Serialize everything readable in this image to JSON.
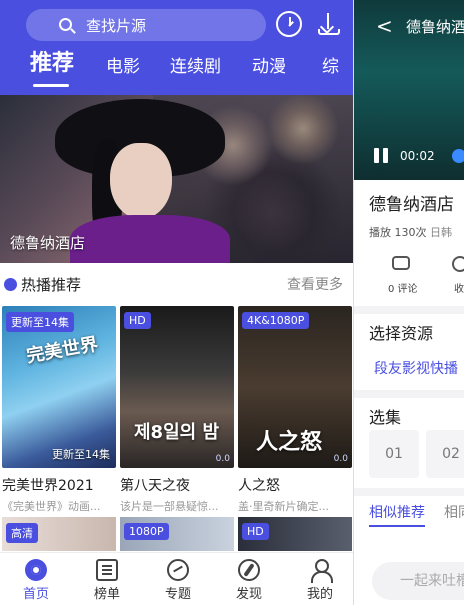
{
  "search": {
    "placeholder": "查找片源"
  },
  "icons": {
    "search": "search-icon",
    "history": "clock-icon",
    "download": "download-icon"
  },
  "tabs": [
    {
      "label": "推荐",
      "active": true
    },
    {
      "label": "电影"
    },
    {
      "label": "连续剧"
    },
    {
      "label": "动漫"
    },
    {
      "label": "综"
    }
  ],
  "banner": {
    "caption": "德鲁纳酒店"
  },
  "hot": {
    "title": "热播推荐",
    "more": "查看更多"
  },
  "cards": [
    {
      "badge": "更新至14集",
      "poster_text": "完美世界",
      "note": "更新至14集",
      "title": "完美世界2021",
      "subtitle": "《完美世界》动画..."
    },
    {
      "badge": "HD",
      "poster_text": "제8일의 밤",
      "note": "",
      "title": "第八天之夜",
      "subtitle": "该片是一部悬疑惊..."
    },
    {
      "badge": "4K&1080P",
      "poster_text": "人之怒",
      "note": "",
      "title": "人之怒",
      "subtitle": "盖·里奇新片确定..."
    }
  ],
  "row2_badges": [
    "高清",
    "1080P",
    "HD"
  ],
  "bottom_nav": [
    {
      "label": "首页",
      "icon": "home-icon",
      "active": true
    },
    {
      "label": "榜单",
      "icon": "list-icon"
    },
    {
      "label": "专题",
      "icon": "compass-icon"
    },
    {
      "label": "发现",
      "icon": "discover-icon"
    },
    {
      "label": "我的",
      "icon": "user-icon"
    }
  ],
  "detail": {
    "back": "<",
    "title": "德鲁纳酒",
    "time": "00:02",
    "name": "德鲁纳酒店",
    "plays": "播放 130次",
    "region": "日韩",
    "comment_label": "0 评论",
    "fav_label": "收",
    "source_heading": "选择资源",
    "source_value": "段友影视快播",
    "episode_heading": "选集",
    "episodes": [
      "01",
      "02"
    ],
    "similar": "相似推荐",
    "similar2": "相同",
    "comment_placeholder": "一起来吐槽"
  }
}
